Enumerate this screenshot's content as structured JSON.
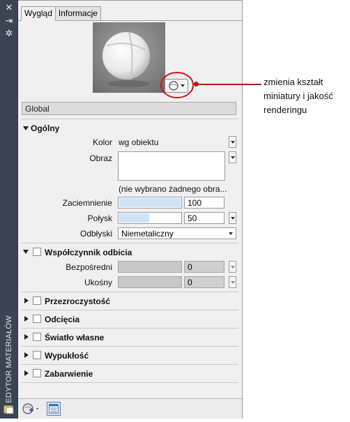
{
  "strip": {
    "title": "EDYTOR MATERIAŁÓW",
    "icons": [
      "close-icon",
      "pin-icon",
      "settings-icon"
    ]
  },
  "tabs": [
    {
      "label": "Wygląd",
      "active": true
    },
    {
      "label": "Informacje",
      "active": false
    }
  ],
  "material_name": "Global",
  "sections": {
    "general": {
      "title": "Ogólny",
      "color_label": "Kolor",
      "color_value": "wg obiektu",
      "image_label": "Obraz",
      "image_note": "(nie wybrano żadnego obra...",
      "shading_label": "Zaciemnienie",
      "shading_value": "100",
      "shading_fill": 1.0,
      "gloss_label": "Połysk",
      "gloss_value": "50",
      "gloss_fill": 0.5,
      "highlights_label": "Odbłyski",
      "highlights_value": "Niemetaliczny"
    },
    "reflectivity": {
      "title": "Współczynnik odbicia",
      "direct_label": "Bezpośredni",
      "direct_value": "0",
      "oblique_label": "Ukośny",
      "oblique_value": "0"
    },
    "transparency": {
      "title": "Przezroczystość"
    },
    "cutouts": {
      "title": "Odcięcia"
    },
    "self_illumination": {
      "title": "Światło własne"
    },
    "bump": {
      "title": "Wypukłość"
    },
    "tint": {
      "title": "Zabarwienie"
    }
  },
  "callout": {
    "text": "zmienia kształt miniatury i jakość renderingu"
  },
  "colors": {
    "strip": "#3b4453",
    "panel": "#f0f0f0",
    "accent": "#b01c1c",
    "slider_fill": "#cfe3f7"
  }
}
